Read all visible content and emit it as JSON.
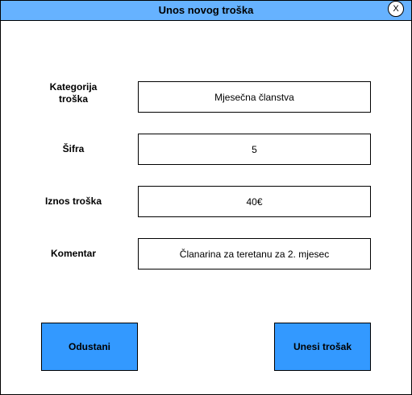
{
  "window": {
    "title": "Unos novog troška",
    "close_label": "X"
  },
  "form": {
    "fields": [
      {
        "label_line1": "Kategorija",
        "label_line2": "troška",
        "value": "Mjesečna članstva"
      },
      {
        "label": "Šifra",
        "value": "5"
      },
      {
        "label": "Iznos troška",
        "value": "40€"
      },
      {
        "label": "Komentar",
        "value": "Članarina za teretanu za 2. mjesec"
      }
    ]
  },
  "buttons": {
    "cancel_label": "Odustani",
    "submit_label": "Unesi trošak"
  },
  "colors": {
    "titlebar": "#66b2ff",
    "button": "#3399ff"
  }
}
